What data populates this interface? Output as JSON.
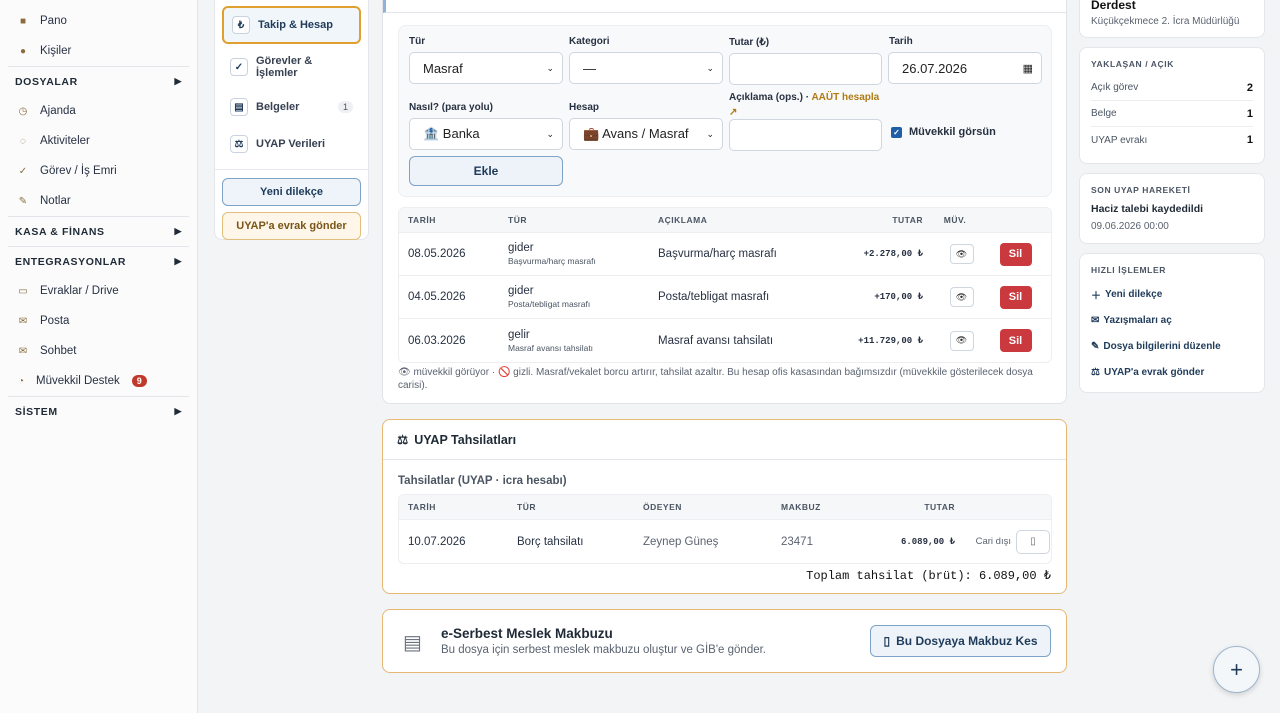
{
  "sidebar": {
    "items_top": [
      {
        "label": "Pano",
        "icon": "dashboard-icon"
      },
      {
        "label": "Kişiler",
        "icon": "contacts-icon"
      }
    ],
    "section_dosyalar": "DOSYALAR",
    "items_dosyalar": [
      {
        "label": "Ajanda",
        "icon": "agenda-icon"
      },
      {
        "label": "Aktiviteler",
        "icon": "activity-icon"
      },
      {
        "label": "Görev / İş Emri",
        "icon": "task-icon"
      },
      {
        "label": "Notlar",
        "icon": "note-icon"
      }
    ],
    "section_kasa": "KASA & FİNANS",
    "section_entegrasyonlar": "ENTEGRASYONLAR",
    "items_entegrasyon": [
      {
        "label": "Evraklar / Drive",
        "icon": "folder-icon"
      },
      {
        "label": "Posta",
        "icon": "mail-icon"
      },
      {
        "label": "Sohbet",
        "icon": "chat-icon"
      },
      {
        "label": "Müvekkil Destek",
        "icon": "support-icon",
        "badge": "9"
      }
    ],
    "section_sistem": "SİSTEM",
    "arrow": "▶"
  },
  "tabs": {
    "items": [
      {
        "label": "Takip & Hesap",
        "icon": "₺",
        "active": true
      },
      {
        "label": "Görevler & İşlemler",
        "icon": "✓"
      },
      {
        "label": "Belgeler",
        "icon": "▤",
        "badge": "1"
      },
      {
        "label": "UYAP Verileri",
        "icon": "⚖"
      }
    ],
    "new_petition": "Yeni dilekçe",
    "send_uyap": "UYAP'a evrak gönder"
  },
  "form": {
    "tur_label": "Tür",
    "tur_value": "Masraf",
    "kategori_label": "Kategori",
    "kategori_value": "—",
    "tutar_label": "Tutar (₺)",
    "tutar_value": "",
    "tarih_label": "Tarih",
    "tarih_value": "26.07.2026",
    "nasil_label": "Nasıl? (para yolu)",
    "nasil_value": "🏦 Banka",
    "hesap_label": "Hesap",
    "hesap_value": "💼 Avans / Masraf",
    "aciklama_label": "Açıklama (ops.) ·",
    "aaut_link": "AAÜT hesapla ↗",
    "aciklama_value": "",
    "muvekkil_label": "Müvekkil görsün",
    "add_label": "Ekle"
  },
  "ledger": {
    "columns": [
      "TARİH",
      "TÜR",
      "AÇIKLAMA",
      "TUTAR",
      "MÜV."
    ],
    "rows": [
      {
        "date": "08.05.2026",
        "type": "gider",
        "subtype": "Başvurma/harç masrafı",
        "desc": "Başvurma/harç masrafı",
        "amount": "+2.278,00 ₺",
        "delete": "Sil"
      },
      {
        "date": "04.05.2026",
        "type": "gider",
        "subtype": "Posta/tebligat masrafı",
        "desc": "Posta/tebligat masrafı",
        "amount": "+170,00 ₺",
        "delete": "Sil"
      },
      {
        "date": "06.03.2026",
        "type": "gelir",
        "subtype": "Masraf avansı tahsilatı",
        "desc": "Masraf avansı tahsilatı",
        "amount": "+11.729,00 ₺",
        "delete": "Sil"
      }
    ],
    "footnote": "👁 müvekkil görüyor · 🚫 gizli. Masraf/vekalet borcu artırır, tahsilat azaltır. Bu hesap ofis kasasından bağımsızdır (müvekkile gösterilecek dosya carisi)."
  },
  "uyap": {
    "title": "UYAP Tahsilatları",
    "subtitle": "Tahsilatlar (UYAP · icra hesabı)",
    "columns": [
      "TARİH",
      "TÜR",
      "ÖDEYEN",
      "MAKBUZ",
      "TUTAR"
    ],
    "rows": [
      {
        "date": "10.07.2026",
        "type": "Borç tahsilatı",
        "payer": "Zeynep Güneş",
        "receipt": "23471",
        "amount": "6.089,00 ₺",
        "note": "Cari dışı"
      }
    ],
    "total": "Toplam tahsilat (brüt): 6.089,00 ₺"
  },
  "smm": {
    "title": "e-Serbest Meslek Makbuzu",
    "description": "Bu dosya için serbest meslek makbuzu oluştur ve GİB'e gönder.",
    "action": "Bu Dosyaya Makbuz Kes"
  },
  "right": {
    "court_title": "Derdest",
    "court": "Küçükçekmece 2. İcra Müdürlüğü",
    "open_header": "YAKLAŞAN / AÇIK",
    "open_rows": [
      {
        "label": "Açık görev",
        "value": "2"
      },
      {
        "label": "Belge",
        "value": "1"
      },
      {
        "label": "UYAP evrakı",
        "value": "1"
      }
    ],
    "last_header": "SON UYAP HAREKETİ",
    "last_title": "Haciz talebi kaydedildi",
    "last_date": "09.06.2026 00:00",
    "quick_header": "HIZLI İŞLEMLER",
    "quick": [
      {
        "icon": "＋",
        "label": "Yeni dilekçe"
      },
      {
        "icon": "✉",
        "label": "Yazışmaları aç"
      },
      {
        "icon": "✎",
        "label": "Dosya bilgilerini düzenle"
      },
      {
        "icon": "⚖",
        "label": "UYAP'a evrak gönder"
      }
    ]
  },
  "fab_label": "+",
  "colors": {
    "accent": "#1f3b5a",
    "gold": "#e0a030",
    "danger": "#c9393e"
  }
}
